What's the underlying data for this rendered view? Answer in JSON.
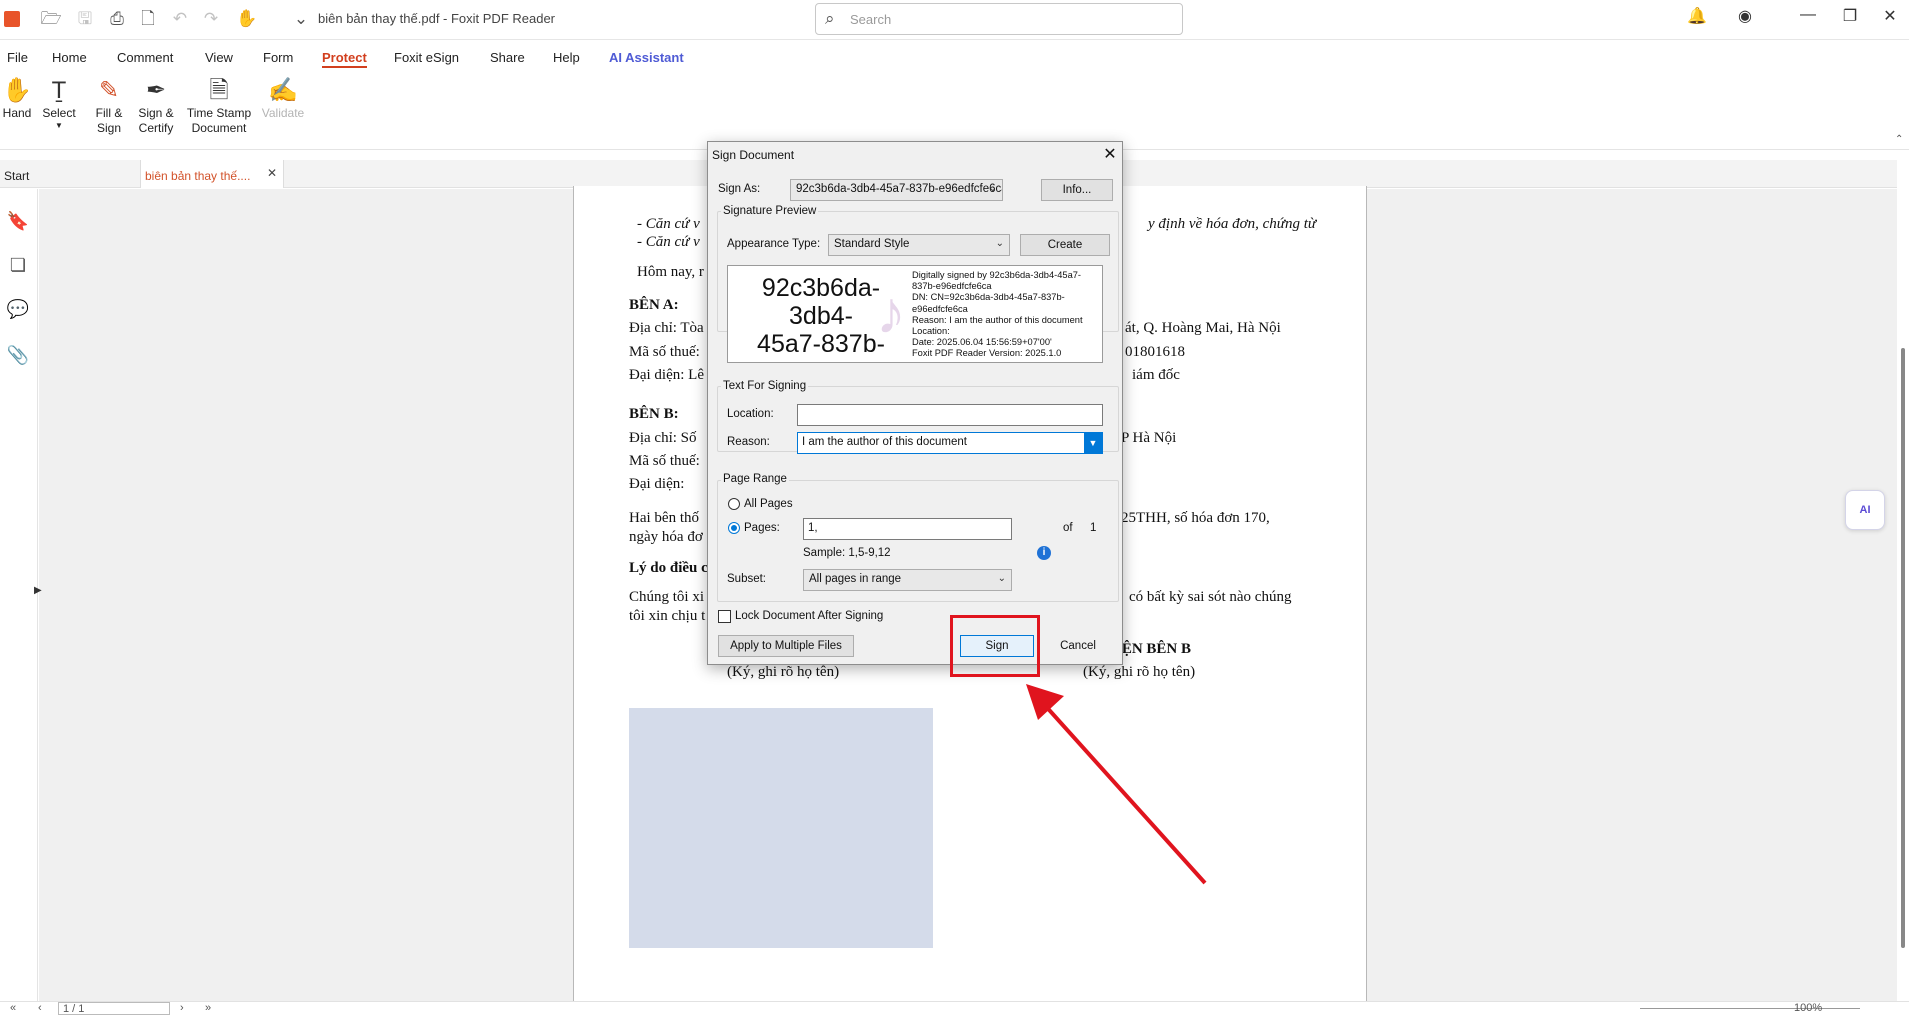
{
  "app": {
    "doc_title": "biên bản thay thế.pdf - Foxit PDF Reader",
    "search_placeholder": "Search"
  },
  "menus": [
    "File",
    "Home",
    "Comment",
    "View",
    "Form",
    "Protect",
    "Foxit eSign",
    "Share",
    "Help",
    "AI Assistant"
  ],
  "active_menu": "Protect",
  "ribbon": {
    "hand": "Hand",
    "select": "Select",
    "fill1": "Fill &",
    "fill2": "Sign",
    "signcert1": "Sign &",
    "signcert2": "Certify",
    "ts1": "Time Stamp",
    "ts2": "Document",
    "validate": "Validate"
  },
  "tabs": {
    "start": "Start",
    "doc": "biên bản thay thế...."
  },
  "document": {
    "l1": "- Căn cứ v",
    "l1r": "y định về hóa đơn, chứng từ",
    "l2": "- Căn cứ v",
    "l3": "Hôm nay, r",
    "benA": "BÊN A:",
    "diachiA": "Địa chỉ: Tòa",
    "diachiAr": "át, Q. Hoàng Mai, Hà Nội",
    "mstA": "Mã số thuế:",
    "mstAr": "01801618",
    "daidienA": "Đại diện: Lê",
    "daidienAr": "iám đốc",
    "benB": "BÊN B:",
    "diachiB": "Địa chỉ: Số",
    "diachiBr": "P Hà Nội",
    "mstB": "Mã số thuế:",
    "daidienB": "Đại diện:",
    "haiben": "Hai bên thố",
    "haibenr": "25THH, số hóa đơn 170,",
    "ngay": "ngày hóa đơ",
    "lydo": "Lý do điều c",
    "chung": "Chúng tôi xi",
    "chungr": "có bất kỳ sai sót nào chúng",
    "toixin": "tôi xin chịu t",
    "daidienbenb": "IỆN BÊN B",
    "ky1": "(Ký, ghi rõ họ tên)",
    "ky2": "(Ký, ghi rõ họ tên)"
  },
  "dialog": {
    "title": "Sign Document",
    "sign_as_label": "Sign As:",
    "sign_as_value": "92c3b6da-3db4-45a7-837b-e96edfcfe6ca",
    "info_btn": "Info...",
    "sig_preview_group": "Signature Preview",
    "appearance_label": "Appearance Type:",
    "appearance_value": "Standard Style",
    "create_btn": "Create",
    "preview_name": "92c3b6da-3db4-\n45a7-837b-\ne96edfcfe6ca",
    "preview_details": "Digitally signed by 92c3b6da-3db4-45a7-\n837b-e96edfcfe6ca\nDN: CN=92c3b6da-3db4-45a7-837b-\ne96edfcfe6ca\nReason: I am the author of this document\nLocation:\nDate: 2025.06.04 15:56:59+07'00'\nFoxit PDF Reader Version: 2025.1.0",
    "text_group": "Text For Signing",
    "location_label": "Location:",
    "location_value": "",
    "reason_label": "Reason:",
    "reason_value": "I am the author of this document",
    "range_group": "Page Range",
    "all_pages": "All Pages",
    "pages_label": "Pages:",
    "pages_value": "1,",
    "of_label": "of",
    "of_total": "1",
    "sample": "Sample: 1,5-9,12",
    "subset_label": "Subset:",
    "subset_value": "All pages in range",
    "lock_label": "Lock Document After Signing",
    "apply_btn": "Apply to Multiple Files",
    "sign_btn": "Sign",
    "cancel_btn": "Cancel"
  },
  "status": {
    "page": "1 / 1",
    "zoom": "100%"
  },
  "ai_float": "AI",
  "colors": {
    "accent": "#d23f1e",
    "annotation": "#e0141e",
    "ai": "#4f5bd5",
    "focus": "#0078d7"
  }
}
